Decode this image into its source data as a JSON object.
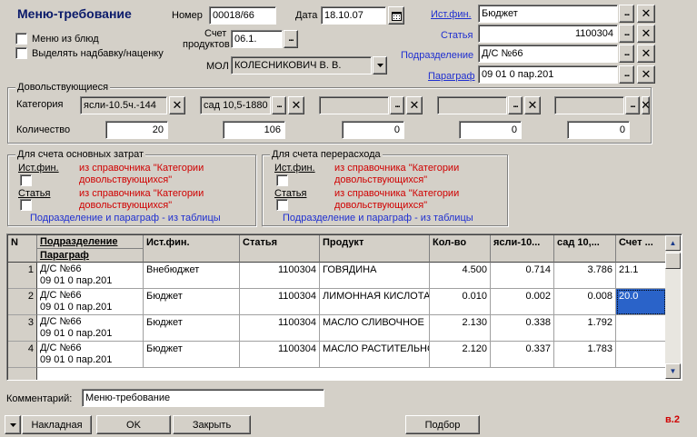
{
  "title": "Меню-требование",
  "header": {
    "number_label": "Номер",
    "number_value": "00018/66",
    "date_label": "Дата",
    "date_value": "18.10.07",
    "menu_from_dishes": "Меню из блюд",
    "highlight_markup": "Выделять надбавку/наценку",
    "account_label_1": "Счет",
    "account_label_2": "продуктов",
    "account_value": "06.1.",
    "mol_label": "МОЛ",
    "mol_value": "КОЛЕСНИКОВИЧ В. В."
  },
  "right": {
    "source_label": "Ист.фин.",
    "source_value": "Бюджет",
    "article_label": "Статья",
    "article_value": "1100304",
    "division_label": "Подразделение",
    "division_value": "Д/С №66",
    "paragraph_label": "Параграф",
    "paragraph_value": "09 01 0 пар.201"
  },
  "dovol": {
    "title": "Довольствующиеся",
    "category_label": "Категория",
    "quantity_label": "Количество",
    "categories": [
      "ясли-10.5ч.-144",
      "сад 10,5-1880",
      "",
      "",
      ""
    ],
    "quantities": [
      "20",
      "106",
      "0",
      "0",
      "0"
    ]
  },
  "main_costs": {
    "title": "Для счета основных затрат",
    "source_label": "Ист.фин.",
    "source_text": "из справочника \"Категории довольствующихся\"",
    "article_label": "Статья",
    "article_text": "из справочника \"Категории довольствующихся\"",
    "note": "Подразделение и параграф - из таблицы"
  },
  "overrun": {
    "title": "Для счета перерасхода",
    "source_label": "Ист.фин.",
    "source_text": "из справочника \"Категории довольствующихся\"",
    "article_label": "Статья",
    "article_text": "из справочника \"Категории довольствующихся\"",
    "note": "Подразделение и параграф - из таблицы"
  },
  "table": {
    "headers": {
      "n": "N",
      "division": "Подразделение",
      "paragraph": "Параграф",
      "source": "Ист.фин.",
      "article": "Статья",
      "product": "Продукт",
      "qty": "Кол-во",
      "yasli": "ясли-10...",
      "sad": "сад 10,...",
      "account": "Счет ..."
    },
    "rows": [
      {
        "n": "1",
        "division": "Д/С №66",
        "paragraph": "09 01 0 пар.201",
        "source": "Внебюджет",
        "article": "1100304",
        "product": "ГОВЯДИНА",
        "qty": "4.500",
        "yasli": "0.714",
        "sad": "3.786",
        "account": "21.1"
      },
      {
        "n": "2",
        "division": "Д/С №66",
        "paragraph": "09 01 0 пар.201",
        "source": "Бюджет",
        "article": "1100304",
        "product": "ЛИМОННАЯ КИСЛОТА",
        "qty": "0.010",
        "yasli": "0.002",
        "sad": "0.008",
        "account": "20.0"
      },
      {
        "n": "3",
        "division": "Д/С №66",
        "paragraph": "09 01 0 пар.201",
        "source": "Бюджет",
        "article": "1100304",
        "product": "МАСЛО СЛИВОЧНОЕ",
        "qty": "2.130",
        "yasli": "0.338",
        "sad": "1.792",
        "account": ""
      },
      {
        "n": "4",
        "division": "Д/С №66",
        "paragraph": "09 01 0 пар.201",
        "source": "Бюджет",
        "article": "1100304",
        "product": "МАСЛО РАСТИТЕЛЬНОЕ",
        "qty": "2.120",
        "yasli": "0.337",
        "sad": "1.783",
        "account": ""
      }
    ]
  },
  "footer": {
    "comment_label": "Комментарий:",
    "comment_value": "Меню-требование",
    "invoice_button": "Накладная",
    "ok_button": "OK",
    "close_button": "Закрыть",
    "selection_button": "Подбор",
    "version": "в.2"
  },
  "icons": {
    "calendar": "calendar-icon",
    "ellipsis": "ellipsis-icon",
    "clear": "close-icon",
    "arrow_down": "arrow-down-icon",
    "scroll_up": "scroll-up-icon",
    "scroll_down": "scroll-down-icon"
  },
  "colors": {
    "background": "#d4d0c8",
    "link_blue": "#1f2fd0",
    "red_text": "#d00000",
    "selection": "#2a63c9",
    "title": "#0a1a6a"
  }
}
